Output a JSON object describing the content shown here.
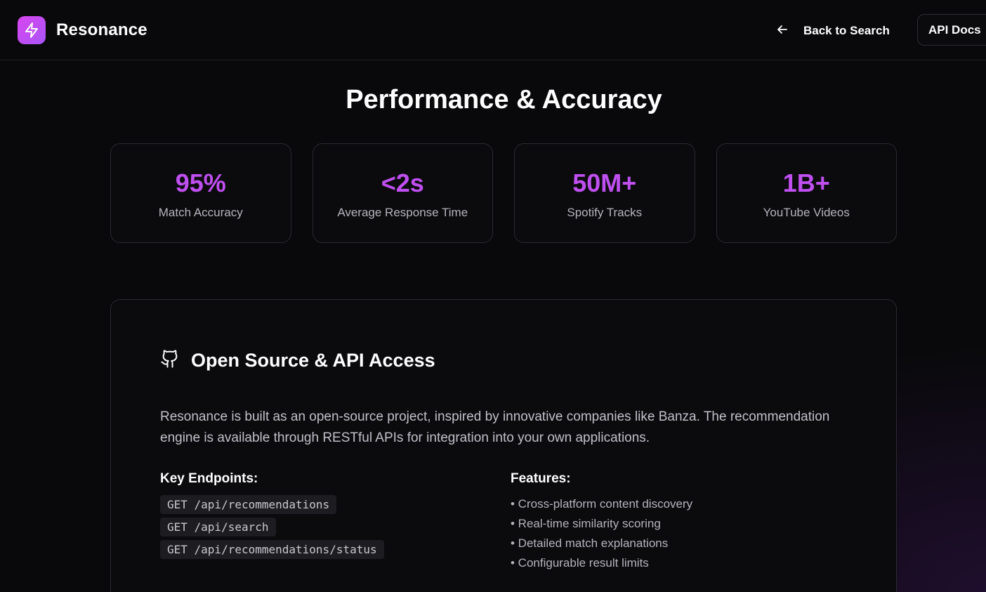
{
  "header": {
    "brand": "Resonance",
    "back_label": "Back to Search",
    "api_docs_label": "API Docs"
  },
  "performance": {
    "title": "Performance & Accuracy",
    "stats": [
      {
        "value": "95%",
        "label": "Match Accuracy"
      },
      {
        "value": "<2s",
        "label": "Average Response Time"
      },
      {
        "value": "50M+",
        "label": "Spotify Tracks"
      },
      {
        "value": "1B+",
        "label": "YouTube Videos"
      }
    ]
  },
  "open_source": {
    "title": "Open Source & API Access",
    "description": "Resonance is built as an open-source project, inspired by innovative companies like Banza. The recommendation engine is available through RESTful APIs for integration into your own applications.",
    "endpoints_title": "Key Endpoints:",
    "endpoints": [
      "GET /api/recommendations",
      "GET /api/search",
      "GET /api/recommendations/status"
    ],
    "features_title": "Features:",
    "features": [
      "• Cross-platform content discovery",
      "• Real-time similarity scoring",
      "• Detailed match explanations",
      "• Configurable result limits"
    ]
  },
  "colors": {
    "accent": "#c04ff0",
    "background": "#09090b",
    "card_border": "#2a2a30"
  },
  "icons": {
    "logo": "lightning-bolt-icon",
    "back": "arrow-left-icon",
    "open_source": "github-icon"
  }
}
